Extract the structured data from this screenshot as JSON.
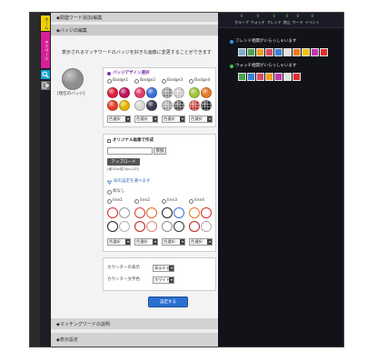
{
  "sidebar": {
    "tabs": [
      {
        "label": "ホーム",
        "color": "#f0d000"
      },
      {
        "label": "マイページ",
        "color": "#d61e96"
      }
    ],
    "search_icon": "search-icon",
    "logout_icon": "logout-icon",
    "search_color": "#1aa3d8",
    "logout_color": "#6a6a6a"
  },
  "main": {
    "section_related": "◆関連ワード追加/編集",
    "section_badge": "◆バッジの編集",
    "description": "表示されるマッチワードのバッジを好きな画像に変更することができます",
    "current_badge_label": "[現在のバッジ]",
    "current_badge_color": "#8e8e8e",
    "design": {
      "title": "バッジデザイン選択",
      "title_color": "#7a3ab0",
      "options": [
        "Badge1",
        "Badge2",
        "Badge3",
        "Badge4"
      ],
      "swatches": [
        [
          "#d81f3c",
          "#c0155e",
          "#e0402a",
          "#e6b300"
        ],
        [
          "#e33d6a",
          "#3a6fd8",
          "#d9d9d9",
          "#3a3a52"
        ],
        [
          "#8a8a8a",
          "#c8c8c8",
          "#a0a0a0",
          "#4a4a4a"
        ],
        [
          "#9fc43a",
          "#e5792a",
          "#c8332b",
          "#222222"
        ]
      ],
      "color_select": "色選択"
    },
    "original": {
      "title": "オリジナル画像で作成",
      "browse": "参照",
      "upload": "アップロード",
      "note": "(横16px縦16px以内)"
    },
    "frame": {
      "title": "枠の設定を選べます",
      "title_color": "#2f6fb8",
      "none": "枠なし",
      "options": [
        "line1",
        "line2",
        "line3",
        "line4"
      ],
      "rings": [
        [
          "#d42a2a",
          "#9a9a9a",
          "#222222",
          "#b0b0b0"
        ],
        [
          "#d83a3a",
          "#e06a2a",
          "#c02020",
          "#e08080"
        ],
        [
          "#222222",
          "#3a6fd8",
          "#8a8a8a",
          "#333333"
        ],
        [
          "#e5792a",
          "#d42a2a",
          "#c02020",
          "#555555"
        ]
      ],
      "color_select": "色選択"
    },
    "counter": {
      "display_label": "カウンターの表示",
      "display_value": "表示する",
      "color_label": "カウンター文字色",
      "color_value": "ホワイト"
    },
    "submit": "設定する",
    "accent": "#2b6fd1",
    "section_matching": "◆マッチングワードの説明",
    "section_display": "◆表示設定"
  },
  "right": {
    "counts": [
      "0",
      "0",
      "0",
      "0",
      "0",
      "0"
    ],
    "tabs": [
      "グループ",
      "ウォッチ",
      "フレンド",
      "禁止",
      "ワード",
      "イベント"
    ],
    "friend_notice": "フレンド相関がいらっしゃいます",
    "friend_dot": "#2a9df4",
    "friend_icons": [
      "#7fb0c8",
      "#4aa34f",
      "#f0a020",
      "#d94b6a",
      "#3b7fd9",
      "#e0e0e0",
      "#f07a20",
      "#f0c400",
      "#c23ab0",
      "#e03030"
    ],
    "watch_notice": "ウォッチ相関がいらっしゃいます",
    "watch_dot": "#3ec43e",
    "watch_icons": [
      "#4aa34f",
      "#3b7fd9",
      "#d94b6a",
      "#f0a020",
      "#c23ab0",
      "#e0e0e0",
      "#e03030"
    ]
  }
}
